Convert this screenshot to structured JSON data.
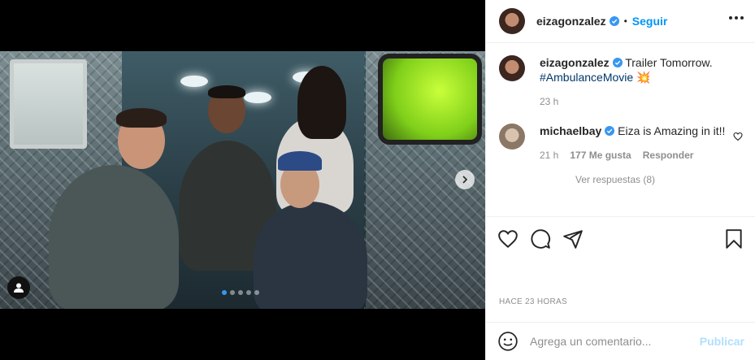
{
  "post_header": {
    "username": "eizagonzalez",
    "separator": "•",
    "follow_label": "Seguir"
  },
  "caption": {
    "username": "eizagonzalez",
    "text": "Trailer Tomorrow.",
    "hashtag": "#AmbulanceMovie",
    "emoji": "💥",
    "time": "23 h"
  },
  "comment": {
    "username": "michaelbay",
    "text": "Eiza is Amazing in it!!",
    "time": "21 h",
    "likes": "177 Me gusta",
    "reply_label": "Responder",
    "see_replies": "Ver respuestas (8)"
  },
  "timestamp": "HACE 23 HORAS",
  "add_comment": {
    "placeholder": "Agrega un comentario...",
    "post_label": "Publicar"
  },
  "carousel": {
    "total": 5,
    "active_index": 0
  },
  "colors": {
    "accent": "#0095f6",
    "hashtag": "#00376b",
    "verified": "#3897f0",
    "post_disabled": "#b2dffc"
  },
  "icons": [
    "verified-badge-icon",
    "more-options-icon",
    "heart-icon",
    "comment-icon",
    "share-icon",
    "bookmark-icon",
    "emoji-icon",
    "chevron-right-icon",
    "user-tag-icon"
  ]
}
